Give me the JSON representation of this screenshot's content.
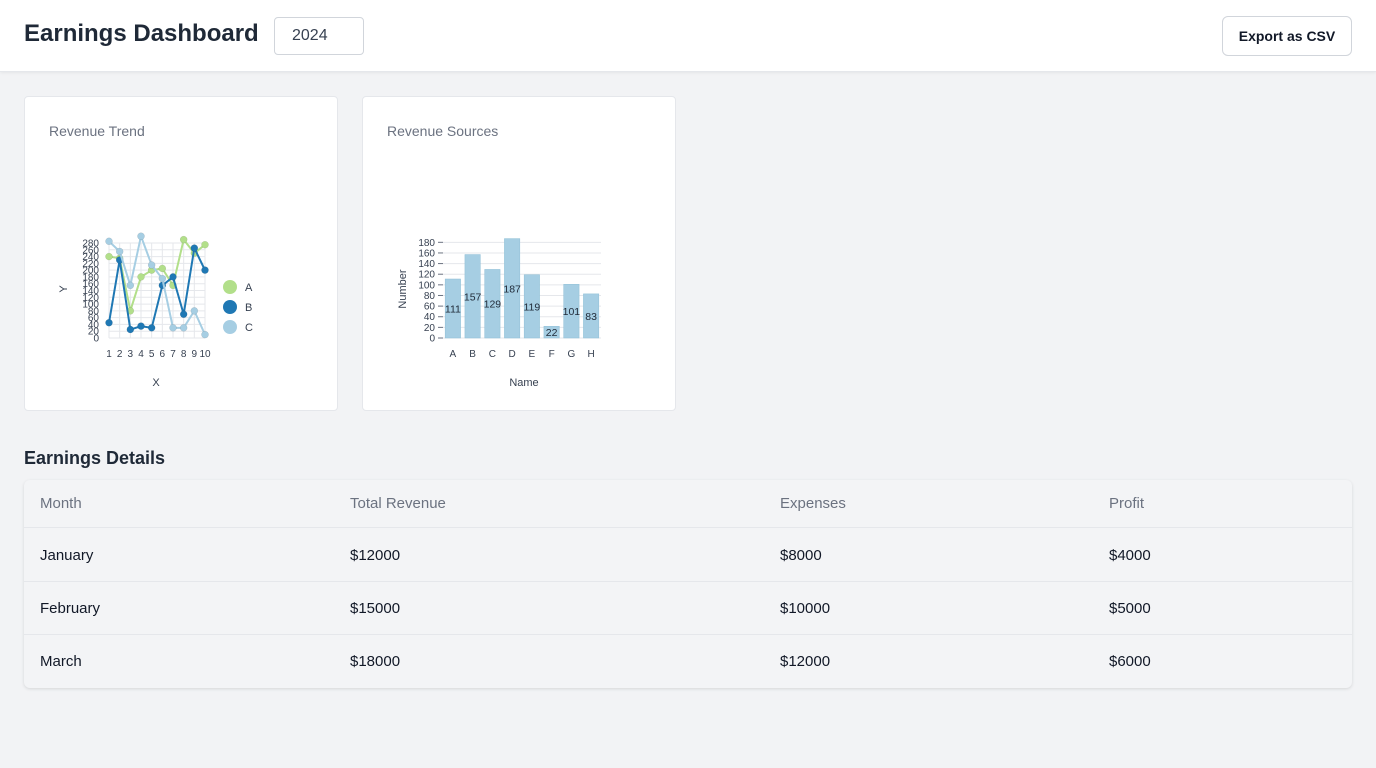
{
  "header": {
    "title": "Earnings Dashboard",
    "year": "2024",
    "export_label": "Export as CSV"
  },
  "cards": {
    "trend": {
      "title": "Revenue Trend",
      "xlabel": "X",
      "ylabel": "Y"
    },
    "sources": {
      "title": "Revenue Sources",
      "xlabel": "Name",
      "ylabel": "Number"
    }
  },
  "chart_data": [
    {
      "type": "line",
      "x": [
        1,
        2,
        3,
        4,
        5,
        6,
        7,
        8,
        9,
        10
      ],
      "ylim": [
        0,
        280
      ],
      "yticks": [
        0,
        20,
        40,
        60,
        80,
        100,
        120,
        140,
        160,
        180,
        200,
        220,
        240,
        260,
        280
      ],
      "grid": true,
      "legend": "right",
      "series": [
        {
          "name": "A",
          "color": "#b2df8a",
          "values": [
            240,
            235,
            80,
            180,
            200,
            205,
            155,
            290,
            250,
            275
          ]
        },
        {
          "name": "B",
          "color": "#1f78b4",
          "values": [
            45,
            230,
            25,
            35,
            30,
            155,
            180,
            70,
            265,
            200
          ]
        },
        {
          "name": "C",
          "color": "#a6cee3",
          "values": [
            285,
            255,
            155,
            300,
            215,
            175,
            30,
            30,
            80,
            10
          ]
        }
      ]
    },
    {
      "type": "bar",
      "categories": [
        "A",
        "B",
        "C",
        "D",
        "E",
        "F",
        "G",
        "H"
      ],
      "values": [
        111,
        157,
        129,
        187,
        119,
        22,
        101,
        83
      ],
      "ylim": [
        0,
        190
      ],
      "yticks": [
        0,
        20,
        40,
        60,
        80,
        100,
        120,
        140,
        160,
        180
      ],
      "grid": true,
      "bar_color": "#a6cee3"
    }
  ],
  "details": {
    "title": "Earnings Details",
    "columns": [
      "Month",
      "Total Revenue",
      "Expenses",
      "Profit"
    ],
    "rows": [
      [
        "January",
        "$12000",
        "$8000",
        "$4000"
      ],
      [
        "February",
        "$15000",
        "$10000",
        "$5000"
      ],
      [
        "March",
        "$18000",
        "$12000",
        "$6000"
      ]
    ]
  }
}
